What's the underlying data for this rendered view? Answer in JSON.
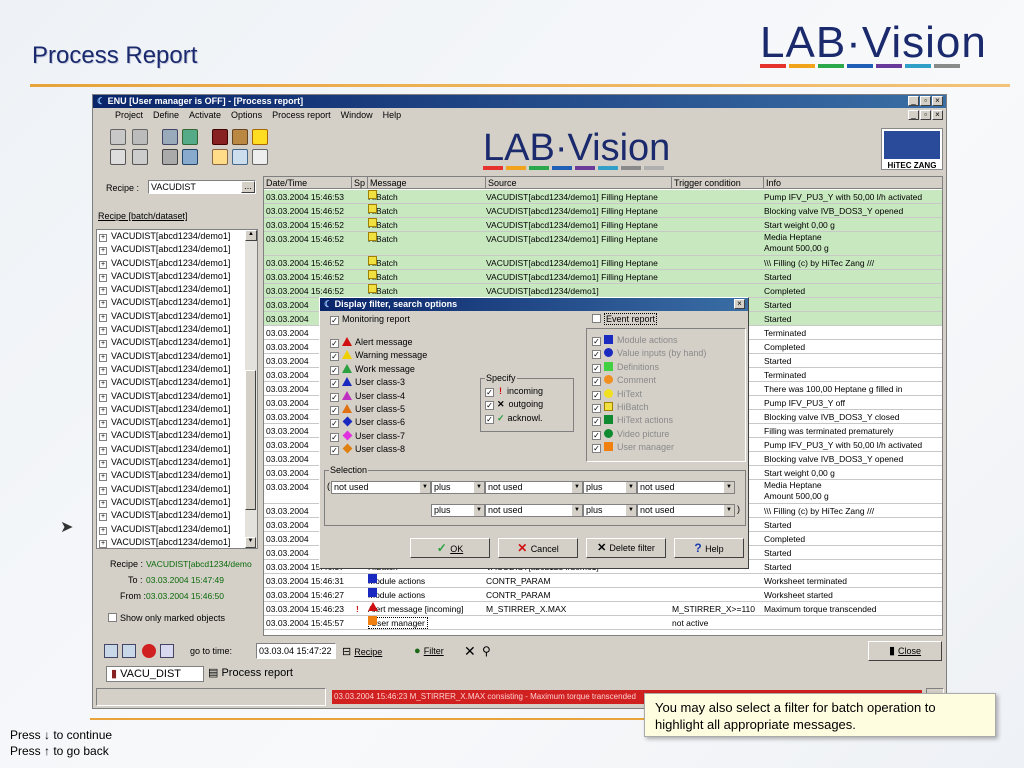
{
  "slide": {
    "title": "Process Report",
    "logo_text": "LAB·Vision",
    "nav_continue": "Press ↓ to continue",
    "nav_back": "Press ↑ to go back",
    "callout": "You may also select a filter for batch operation to highlight all appropriate messages."
  },
  "window": {
    "title": "ENU   [User manager is OFF] - [Process report]",
    "menu": [
      "Project",
      "Define",
      "Activate",
      "Options",
      "Process report",
      "Window",
      "Help"
    ],
    "center_logo": "LAB·Vision",
    "hitec_label": "HiTEC ZANG"
  },
  "left": {
    "recipe_label": "Recipe :",
    "recipe_value": "VACUDIST",
    "batch_link": "Recipe [batch/dataset]",
    "tree_items": [
      "VACUDIST[abcd1234/demo1]",
      "VACUDIST[abcd1234/demo1]",
      "VACUDIST[abcd1234/demo1]",
      "VACUDIST[abcd1234/demo1]",
      "VACUDIST[abcd1234/demo1]",
      "VACUDIST[abcd1234/demo1]",
      "VACUDIST[abcd1234/demo1]",
      "VACUDIST[abcd1234/demo1]",
      "VACUDIST[abcd1234/demo1]",
      "VACUDIST[abcd1234/demo1]",
      "VACUDIST[abcd1234/demo1]",
      "VACUDIST[abcd1234/demo1]",
      "VACUDIST[abcd1234/demo1]",
      "VACUDIST[abcd1234/demo1]",
      "VACUDIST[abcd1234/demo1]",
      "VACUDIST[abcd1234/demo1]",
      "VACUDIST[abcd1234/demo1]",
      "VACUDIST[abcd1234/demo1]",
      "VACUDIST[abcd1234/demo1]",
      "VACUDIST[abcd1234/demo1]",
      "VACUDIST[abcd1234/demo1]",
      "VACUDIST[abcd1234/demo1]",
      "VACUDIST[abcd1234/demo1]",
      "VACUDIST[abcd1234/demo1]"
    ],
    "sel_recipe_label": "Recipe :",
    "sel_recipe_value": "VACUDIST[abcd1234/demo",
    "to_label": "To :",
    "to_value": "03.03.2004 15:47:49",
    "from_label": "From :",
    "from_value": "03.03.2004 15:46:50",
    "marked_only": "Show only marked objects"
  },
  "table": {
    "headers": [
      "Date/Time",
      "Sp",
      "Message",
      "Source",
      "Trigger condition",
      "Info"
    ],
    "rows": [
      {
        "t": "03.03.2004 15:46:53",
        "m": "HiBatch",
        "s": "VACUDIST[abcd1234/demo1] Filling Heptane",
        "tr": "",
        "i": "Pump IFV_PU3_Y with 50,00 l/h activated",
        "g": true
      },
      {
        "t": "03.03.2004 15:46:52",
        "m": "HiBatch",
        "s": "VACUDIST[abcd1234/demo1] Filling Heptane",
        "tr": "",
        "i": "Blocking valve IVB_DOS3_Y opened",
        "g": true
      },
      {
        "t": "03.03.2004 15:46:52",
        "m": "HiBatch",
        "s": "VACUDIST[abcd1234/demo1] Filling Heptane",
        "tr": "",
        "i": "Start weight 0,00 g",
        "g": true
      },
      {
        "t": "03.03.2004 15:46:52",
        "m": "HiBatch",
        "s": "VACUDIST[abcd1234/demo1] Filling Heptane",
        "tr": "",
        "i": "Media Heptane",
        "i2": "Amount 500,00 g",
        "g": true,
        "tall": true
      },
      {
        "t": "03.03.2004 15:46:52",
        "m": "HiBatch",
        "s": "VACUDIST[abcd1234/demo1] Filling Heptane",
        "tr": "",
        "i": "\\\\\\ Filling   (c) by HiTec Zang ///",
        "g": true
      },
      {
        "t": "03.03.2004 15:46:52",
        "m": "HiBatch",
        "s": "VACUDIST[abcd1234/demo1] Filling Heptane",
        "tr": "",
        "i": "Started",
        "g": true
      },
      {
        "t": "03.03.2004 15:46:52",
        "m": "HiBatch",
        "s": "VACUDIST[abcd1234/demo1]",
        "tr": "",
        "i": "Completed",
        "g": true
      },
      {
        "t": "03.03.2004",
        "m": "",
        "s": "",
        "tr": "",
        "i": "Started",
        "g": true
      },
      {
        "t": "03.03.2004",
        "m": "",
        "s": "",
        "tr": "",
        "i": "Started",
        "g": true
      },
      {
        "t": "03.03.2004",
        "m": "",
        "s": "",
        "tr": "",
        "i": "Terminated",
        "g": false
      },
      {
        "t": "03.03.2004",
        "m": "",
        "s": "",
        "tr": "",
        "i": "Completed",
        "g": false
      },
      {
        "t": "03.03.2004",
        "m": "",
        "s": "",
        "tr": "",
        "i": "Started",
        "g": false
      },
      {
        "t": "03.03.2004",
        "m": "",
        "s": "",
        "tr": "",
        "i": "Terminated",
        "g": false
      },
      {
        "t": "03.03.2004",
        "m": "",
        "s": "",
        "tr": "",
        "i": "There was 100,00 Heptane g filled in",
        "g": false
      },
      {
        "t": "03.03.2004",
        "m": "",
        "s": "",
        "tr": "",
        "i": "Pump IFV_PU3_Y off",
        "g": false
      },
      {
        "t": "03.03.2004",
        "m": "",
        "s": "",
        "tr": "",
        "i": "Blocking valve IVB_DOS3_Y closed",
        "g": false
      },
      {
        "t": "03.03.2004",
        "m": "",
        "s": "",
        "tr": "",
        "i": "Filling was terminated prematurely",
        "g": false
      },
      {
        "t": "03.03.2004",
        "m": "",
        "s": "",
        "tr": "",
        "i": "Pump IFV_PU3_Y with 50,00 l/h activated",
        "g": false
      },
      {
        "t": "03.03.2004",
        "m": "",
        "s": "",
        "tr": "",
        "i": "Blocking valve IVB_DOS3_Y opened",
        "g": false
      },
      {
        "t": "03.03.2004",
        "m": "",
        "s": "",
        "tr": "",
        "i": "Start weight 0,00 g",
        "g": false
      },
      {
        "t": "03.03.2004",
        "m": "",
        "s": "",
        "tr": "",
        "i": "Media Heptane",
        "i2": "Amount 500,00 g",
        "g": false,
        "tall": true
      },
      {
        "t": "03.03.2004",
        "m": "",
        "s": "",
        "tr": "",
        "i": "\\\\\\ Filling   (c) by HiTec Zang ///",
        "g": false
      },
      {
        "t": "03.03.2004",
        "m": "",
        "s": "",
        "tr": "",
        "i": "Started",
        "g": false
      },
      {
        "t": "03.03.2004",
        "m": "",
        "s": "",
        "tr": "",
        "i": "Completed",
        "g": false
      },
      {
        "t": "03.03.2004",
        "m": "",
        "s": "",
        "tr": "",
        "i": "Started",
        "g": false
      },
      {
        "t": "03.03.2004 15:46:37",
        "m": "HiBatch",
        "s": "VACUDIST[abcd1234/demo1]",
        "tr": "",
        "i": "Started",
        "g": false
      },
      {
        "t": "03.03.2004 15:46:31",
        "m": "Module actions",
        "s": "CONTR_PARAM",
        "tr": "",
        "i": "Worksheet terminated",
        "g": false
      },
      {
        "t": "03.03.2004 15:46:27",
        "m": "Module actions",
        "s": "CONTR_PARAM",
        "tr": "",
        "i": "Worksheet started",
        "g": false
      },
      {
        "t": "03.03.2004 15:46:23",
        "sp": "!",
        "m": "Alert message [incoming]",
        "s": "M_STIRRER_X.MAX",
        "tr": "M_STIRRER_X>=110",
        "i": "Maximum torque transcended",
        "g": false
      },
      {
        "t": "03.03.2004 15:45:57",
        "m": "User manager",
        "s": "",
        "tr": "not active",
        "i": "",
        "g": false
      }
    ]
  },
  "dialog": {
    "title": "Display filter, search options",
    "monitoring": "Monitoring report",
    "event": "Event report",
    "left_list": [
      "Alert message",
      "Warning message",
      "Work message",
      "User class-3",
      "User class-4",
      "User class-5",
      "User class-6",
      "User class-7",
      "User class-8"
    ],
    "right_list": [
      "Module actions",
      "Value inputs (by hand)",
      "Definitions",
      "Comment",
      "HiText",
      "HiBatch",
      "HiText actions",
      "Video picture",
      "User manager"
    ],
    "specify_title": "Specify",
    "specify": [
      "incoming",
      "outgoing",
      "acknowl."
    ],
    "selection_title": "Selection",
    "row1": [
      "not used",
      "plus",
      "not used",
      "plus",
      "not used"
    ],
    "row2": [
      "plus",
      "not used",
      "plus",
      "not used"
    ],
    "ok": "OK",
    "cancel": "Cancel",
    "delete": "Delete filter",
    "help": "Help"
  },
  "bottom": {
    "goto_label": "go to time:",
    "goto_value": "03.03.04 15:47:22",
    "recipe_btn": "Recipe",
    "filter_btn": "Filter",
    "close_btn": "Close",
    "tab1": "VACU_DIST",
    "tab2": "Process report",
    "status_msg": "03.03.2004 15:46:23 M_STIRRER_X.MAX consisting - Maximum torque transcended"
  },
  "colors": {
    "accent": "#e8a33a",
    "brand": "#1a2a6c",
    "green_row": "#c8e8c0",
    "titlebar": "#0a246a"
  }
}
